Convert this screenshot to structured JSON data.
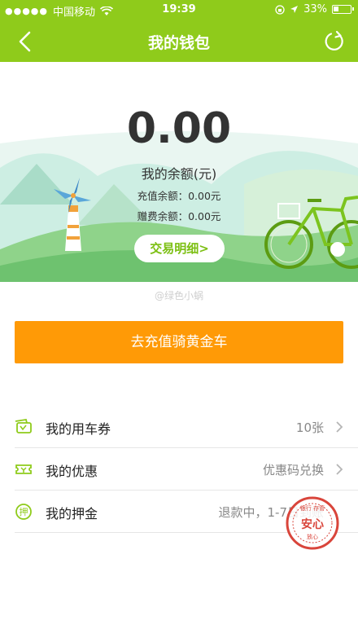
{
  "statusbar": {
    "carrier": "中国移动",
    "time": "19:39",
    "battery": "33%",
    "battery_level": 0.33
  },
  "header": {
    "title": "我的钱包"
  },
  "wallet": {
    "balance": "0.00",
    "balance_label": "我的余额(元)",
    "recharge_balance": "充值余额：0.00元",
    "gift_balance": "赠费余额：0.00元",
    "details_button": "交易明细>"
  },
  "watermark": "@绿色小蜗",
  "recharge_button": "去充值骑黄金车",
  "list": [
    {
      "label": "我的用车券",
      "value": "10张",
      "icon": "ticket-icon"
    },
    {
      "label": "我的优惠",
      "value": "优惠码兑换",
      "icon": "coupon-icon"
    },
    {
      "label": "我的押金",
      "value": "退款中，1-7日到账",
      "icon": "deposit-icon"
    }
  ],
  "stamp": {
    "main": "安心",
    "ring": "银行 存管",
    "small": "放心"
  },
  "colors": {
    "brand": "#8fcb1b",
    "button": "#ff9a06"
  }
}
